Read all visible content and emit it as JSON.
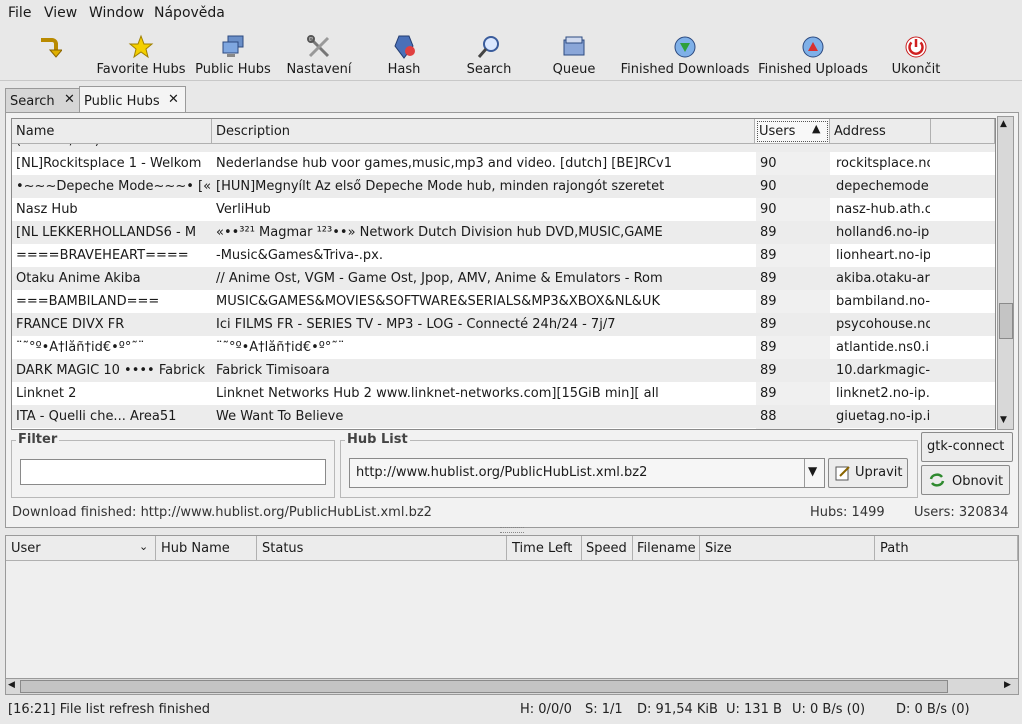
{
  "menubar": {
    "items": [
      {
        "label": "File"
      },
      {
        "label": "View"
      },
      {
        "label": "Window"
      },
      {
        "label": "Nápověda"
      }
    ]
  },
  "toolbar": {
    "buttons": [
      {
        "label": "",
        "icon": "connect-arrow-icon"
      },
      {
        "label": "Favorite Hubs",
        "icon": "star-icon"
      },
      {
        "label": "Public Hubs",
        "icon": "computers-icon"
      },
      {
        "label": "Nastavení",
        "icon": "tools-icon"
      },
      {
        "label": "Hash",
        "icon": "hash-icon"
      },
      {
        "label": "Search",
        "icon": "magnifier-icon"
      },
      {
        "label": "Queue",
        "icon": "queue-folder-icon"
      },
      {
        "label": "Finished Downloads",
        "icon": "download-globe-icon"
      },
      {
        "label": "Finished Uploads",
        "icon": "upload-globe-icon"
      },
      {
        "label": "Ukončit",
        "icon": "power-icon"
      }
    ]
  },
  "tabs": [
    {
      "label": "Search",
      "active": false
    },
    {
      "label": "Public Hubs",
      "active": true
    }
  ],
  "hub_table": {
    "columns": [
      "Name",
      "Description",
      "Users",
      "Address"
    ],
    "sorted_column": "Users",
    "partial_row": {
      "name": "(~~~ ~,~~) ~ ~~~ ~~~~~~ ~",
      "desc": "~~~~~ ~ ~~~~~ ~~~~ ~~~~~~~ ~~~~~~~~~ ~~~ ~~~~~",
      "users": "90",
      "address": "~~~~~~~~~~~~"
    },
    "rows": [
      {
        "name": "[NL]Rockitsplace 1 - Welkom",
        "desc": "Nederlandse hub voor games,music,mp3 and video. [dutch] [BE]RCv1",
        "users": "90",
        "address": "rockitsplace.no"
      },
      {
        "name": "•~~~Depeche Mode~~~• [«",
        "desc": "[HUN]Megnyílt Az első Depeche Mode hub, minden rajongót szeretet",
        "users": "90",
        "address": "depechemode."
      },
      {
        "name": "Nasz Hub",
        "desc": "VerliHub",
        "users": "90",
        "address": "nasz-hub.ath.c"
      },
      {
        "name": "[NL    LEKKERHOLLANDS6 - M",
        "desc": "«••³²¹ Magmar ¹²³••» Network Dutch Division hub   DVD,MUSIC,GAME",
        "users": "89",
        "address": "holland6.no-ip"
      },
      {
        "name": "====BRAVEHEART====",
        "desc": "-Music&Games&Triva-.px.",
        "users": "89",
        "address": "lionheart.no-ip"
      },
      {
        "name": "Otaku Anime Akiba",
        "desc": "// Anime Ost, VGM - Game Ost, Jpop, AMV, Anime & Emulators - Rom",
        "users": "89",
        "address": "akiba.otaku-ar"
      },
      {
        "name": "===BAMBILAND===",
        "desc": "MUSIC&GAMES&MOVIES&SOFTWARE&SERIALS&MP3&XBOX&NL&UK",
        "users": "89",
        "address": "bambiland.no-i"
      },
      {
        "name": "FRANCE DIVX FR",
        "desc": "Ici FILMS FR - SERIES TV - MP3 - LOG - Connecté 24h/24 - 7j/7",
        "users": "89",
        "address": "psycohouse.no"
      },
      {
        "name": "¨˜°º•Á†låñ†id€•º°˜¨",
        "desc": "¨˜°º•Á†låñ†id€•º°˜¨",
        "users": "89",
        "address": "atlantide.ns0.i"
      },
      {
        "name": "DARK MAGIC 10 •••• Fabrick",
        "desc": "Fabrick Timisoara",
        "users": "89",
        "address": "10.darkmagic-"
      },
      {
        "name": "Linknet 2",
        "desc": "Linknet Networks Hub 2 www.linknet-networks.com][15GiB min][ all",
        "users": "89",
        "address": "linknet2.no-ip."
      },
      {
        "name": "ITA - Quelli che... Area51",
        "desc": "We Want To Believe",
        "users": "88",
        "address": "giuetag.no-ip.i"
      }
    ]
  },
  "filter": {
    "title": "Filter",
    "value": ""
  },
  "hublist": {
    "title": "Hub List",
    "selected": "http://www.hublist.org/PublicHubList.xml.bz2",
    "edit_label": "Upravit",
    "connect_label": "gtk-connect",
    "refresh_label": "Obnovit"
  },
  "panel_status": {
    "message": "Download finished: http://www.hublist.org/PublicHubList.xml.bz2",
    "hubs": "Hubs: 1499",
    "users": "Users: 320834"
  },
  "transfers": {
    "columns": [
      "User",
      "Hub Name",
      "Status",
      "Time Left",
      "Speed",
      "Filename",
      "Size",
      "Path"
    ]
  },
  "statusbar": {
    "message": "[16:21] File list refresh finished",
    "hubs": "H: 0/0/0",
    "slots": "S: 1/1",
    "downloaded": "D: 91,54 KiB",
    "uploaded": "U: 131 B",
    "up_speed": "U: 0 B/s (0)",
    "down_speed": "D: 0 B/s (0)"
  }
}
